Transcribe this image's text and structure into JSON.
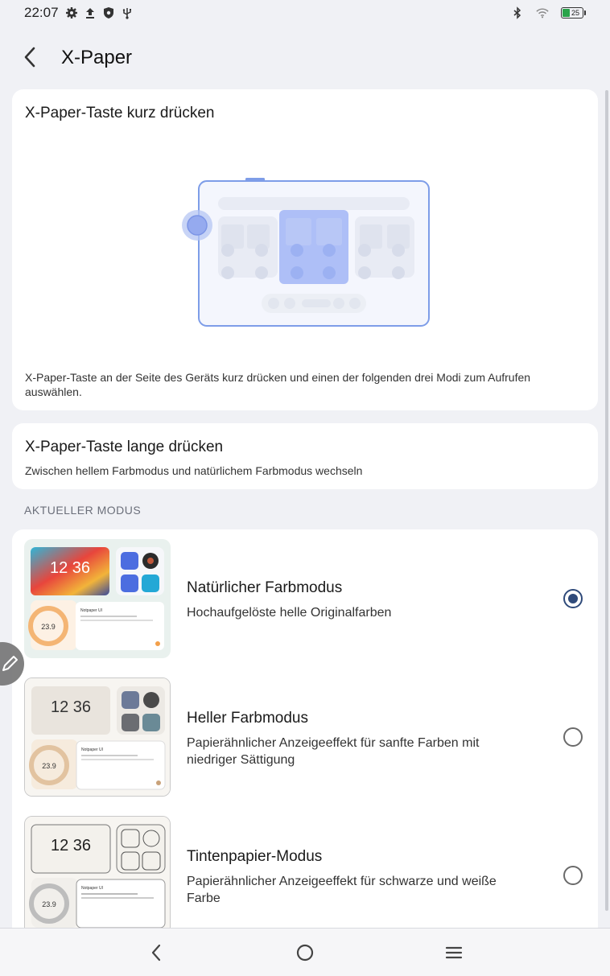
{
  "status_bar": {
    "time": "22:07",
    "battery_level": "25",
    "icons": [
      "gear-icon",
      "upload-icon",
      "shield-icon",
      "usb-icon",
      "bluetooth-icon",
      "wifi-icon",
      "battery-icon"
    ]
  },
  "app_bar": {
    "title": "X-Paper"
  },
  "short_press": {
    "title": "X-Paper-Taste kurz drücken",
    "description": "X-Paper-Taste an der Seite des Geräts kurz drücken und einen der folgenden drei Modi zum Aufrufen auswählen."
  },
  "long_press": {
    "title": "X-Paper-Taste lange drücken",
    "description": "Zwischen hellem Farbmodus und natürlichem Farbmodus wechseln"
  },
  "section_header": "AKTUELLER MODUS",
  "modes": [
    {
      "title": "Natürlicher Farbmodus",
      "description": "Hochaufgelöste helle Originalfarben",
      "selected": true,
      "thumb_clock": "12 36",
      "thumb_temp": "23.9",
      "thumb_card": "Notpaper UI"
    },
    {
      "title": "Heller Farbmodus",
      "description": "Papierähnlicher Anzeigeeffekt für sanfte Farben mit niedriger Sättigung",
      "selected": false,
      "thumb_clock": "12 36",
      "thumb_temp": "23.9",
      "thumb_card": "Notpaper UI"
    },
    {
      "title": "Tintenpapier-Modus",
      "description": "Papierähnlicher Anzeigeeffekt für schwarze und weiße Farbe",
      "selected": false,
      "thumb_clock": "12 36",
      "thumb_temp": "23.9",
      "thumb_card": "Notpaper UI"
    }
  ],
  "colors": {
    "accent": "#2f4a7a",
    "illustration_blue": "#8fa8f0",
    "background": "#f0f1f5"
  },
  "nav_bar": {
    "icons": [
      "back-triangle-icon",
      "home-circle-icon",
      "menu-lines-icon"
    ]
  }
}
